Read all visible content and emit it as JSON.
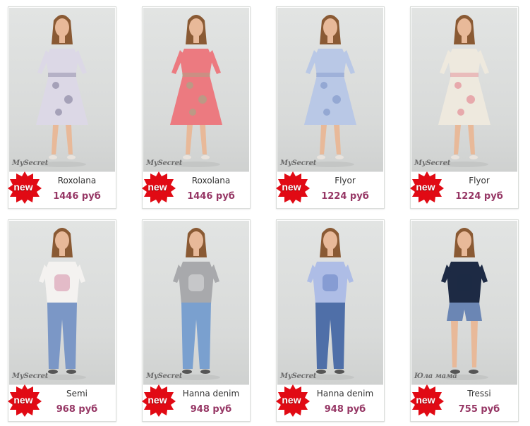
{
  "colors": {
    "badge": "#e10a14",
    "price": "#963765",
    "border": "#d9dcd9"
  },
  "products": [
    {
      "name": "Roxolana",
      "price": "1446 руб",
      "brand": "MySecret",
      "badge": "new",
      "outfit": "dress",
      "top": "#dcd8e6",
      "bottom": "#dcd8e6",
      "accent": "#6d6a8a"
    },
    {
      "name": "Roxolana",
      "price": "1446 руб",
      "brand": "MySecret",
      "badge": "new",
      "outfit": "dress",
      "top": "#ec7a80",
      "bottom": "#ec7a80",
      "accent": "#8bb78a"
    },
    {
      "name": "Flyor",
      "price": "1224 руб",
      "brand": "MySecret",
      "badge": "new",
      "outfit": "dress",
      "top": "#b9c8e6",
      "bottom": "#b9c8e6",
      "accent": "#6f88c0"
    },
    {
      "name": "Flyor",
      "price": "1224 руб",
      "brand": "MySecret",
      "badge": "new",
      "outfit": "dress",
      "top": "#eee9de",
      "bottom": "#eee9de",
      "accent": "#e06a7a"
    },
    {
      "name": "Semi",
      "price": "968 руб",
      "brand": "MySecret",
      "badge": "new",
      "outfit": "pants",
      "top": "#f4f2f0",
      "bottom": "#7b97c6",
      "accent": "#c2567d"
    },
    {
      "name": "Hanna denim",
      "price": "948 руб",
      "brand": "MySecret",
      "badge": "new",
      "outfit": "pants",
      "top": "#a8a9ac",
      "bottom": "#7aa0cf",
      "accent": "#ffffff"
    },
    {
      "name": "Hanna denim",
      "price": "948 руб",
      "brand": "MySecret",
      "badge": "new",
      "outfit": "pants",
      "top": "#aebde6",
      "bottom": "#4f6fa8",
      "accent": "#3b5fb0"
    },
    {
      "name": "Tressi",
      "price": "755 руб",
      "brand": "Юла мама",
      "badge": "new",
      "outfit": "shorts",
      "top": "#1d2a44",
      "bottom": "#6b86b4",
      "accent": "#1d2a44"
    }
  ]
}
